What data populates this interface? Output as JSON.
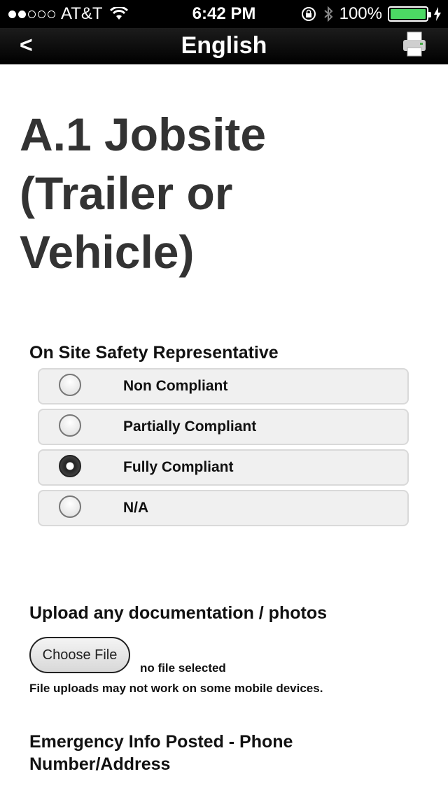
{
  "status_bar": {
    "carrier": "AT&T",
    "time": "6:42 PM",
    "battery": "100%",
    "signal_bars_filled": 2,
    "signal_bars_total": 5
  },
  "nav": {
    "back_label": "<",
    "title": "English",
    "print_icon": "printer-icon"
  },
  "page_title": "A.1 Jobsite (Trailer or Vehicle)",
  "questions": {
    "safety_rep": {
      "label": "On Site Safety Representative",
      "options": [
        {
          "label": "Non Compliant",
          "checked": false
        },
        {
          "label": "Partially Compliant",
          "checked": false
        },
        {
          "label": "Fully Compliant",
          "checked": true
        },
        {
          "label": "N/A",
          "checked": false
        }
      ]
    },
    "upload": {
      "label": "Upload any documentation / photos",
      "button_label": "Choose File",
      "file_status": "no file selected",
      "note": "File uploads may not work on some mobile devices."
    },
    "emergency": {
      "label": "Emergency Info Posted - Phone Number/Address"
    }
  },
  "colors": {
    "battery_green": "#4cd964",
    "nav_background": "#000000"
  }
}
